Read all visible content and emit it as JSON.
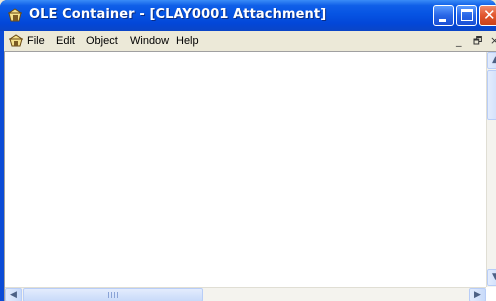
{
  "window": {
    "title": "OLE Container - [CLAY0001 Attachment]",
    "title_icon": "ole-container-app-icon"
  },
  "title_buttons": {
    "minimize": "minimize-icon",
    "maximize": "maximize-icon",
    "close": "close-icon",
    "close_glyph": "✕"
  },
  "menubar": {
    "items": [
      "File",
      "Edit",
      "Object",
      "Window",
      "Help"
    ],
    "child_controls": {
      "minimize": "_",
      "restore": "🗗",
      "close": "×"
    }
  },
  "scrollbars": {
    "up": "▲",
    "down": "▼",
    "left": "◀",
    "right": "▶"
  },
  "colors": {
    "titlebar": "#0654e3",
    "close_button": "#e1552d",
    "menubar": "#ece9d8",
    "client": "#ffffff"
  }
}
